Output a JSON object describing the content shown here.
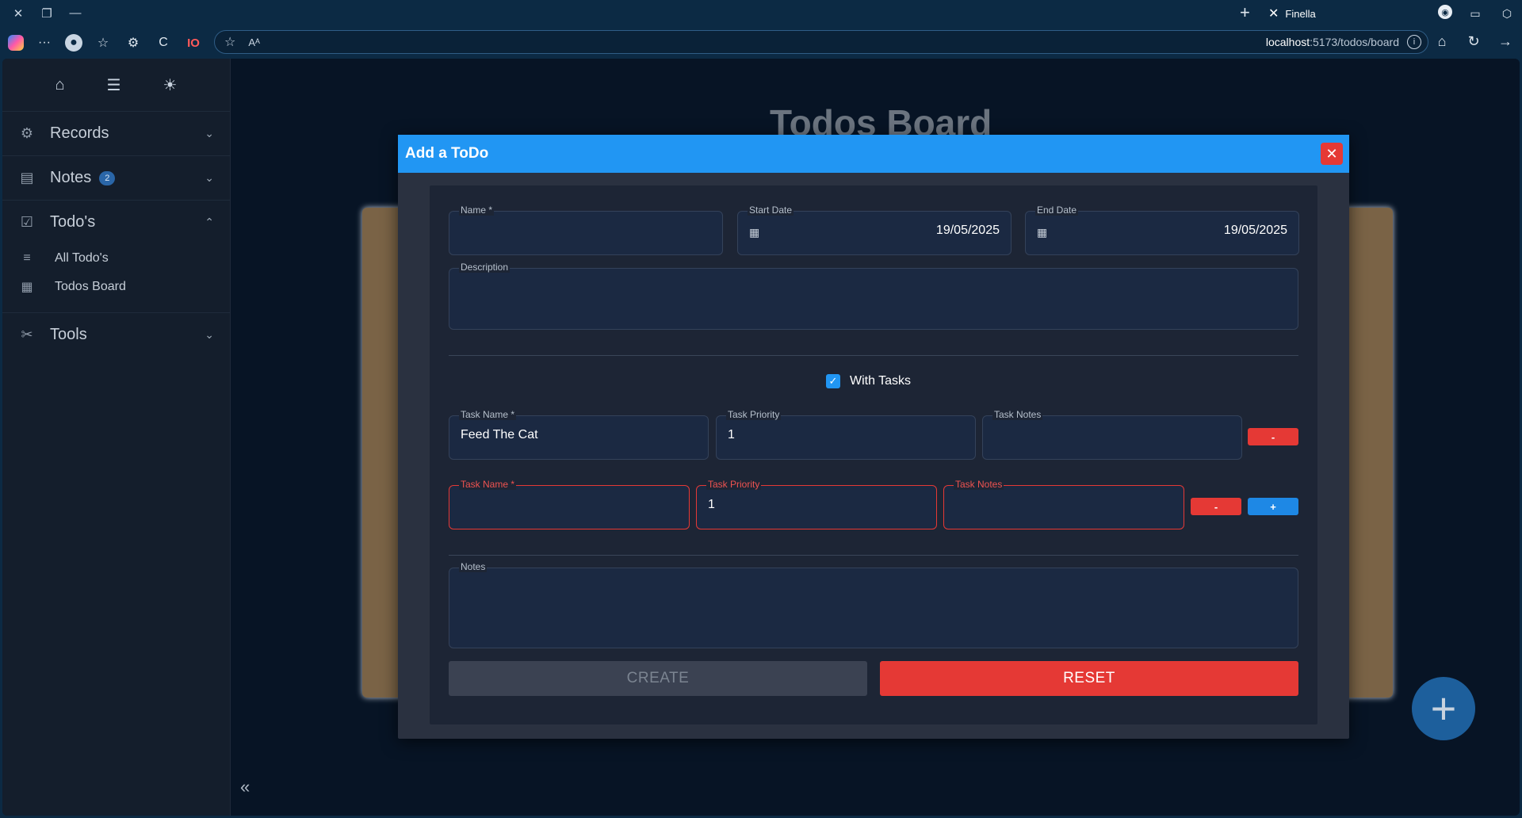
{
  "browser": {
    "tab_title": "Finella",
    "url_host": "localhost",
    "url_path": ":5173/todos/board",
    "ext_label": "IO"
  },
  "sidebar": {
    "sections": [
      {
        "label": "Records",
        "icon": "records-icon"
      },
      {
        "label": "Notes",
        "icon": "notes-icon",
        "badge": "2"
      },
      {
        "label": "Todo's",
        "icon": "todos-icon"
      },
      {
        "label": "Tools",
        "icon": "tools-icon"
      }
    ],
    "todo_items": [
      {
        "label": "All Todo's",
        "icon": "edit-list-icon"
      },
      {
        "label": "Todos Board",
        "icon": "board-icon"
      }
    ]
  },
  "page": {
    "title": "Todos Board"
  },
  "modal": {
    "title": "Add a ToDo",
    "name_label": "Name",
    "name_value": "",
    "start_label": "Start Date",
    "start_value": "19/05/2025",
    "end_label": "End Date",
    "end_value": "19/05/2025",
    "description_label": "Description",
    "with_tasks_label": "With Tasks",
    "with_tasks_checked": true,
    "tasks": [
      {
        "name_label": "Task Name",
        "name_value": "Feed The Cat",
        "priority_label": "Task Priority",
        "priority_value": "1",
        "notes_label": "Task Notes",
        "notes_value": "",
        "error": false
      },
      {
        "name_label": "Task Name",
        "name_value": "",
        "priority_label": "Task Priority",
        "priority_value": "1",
        "notes_label": "Task Notes",
        "notes_value": "",
        "error": true
      }
    ],
    "remove_label": "-",
    "add_label": "+",
    "notes_label": "Notes",
    "create_label": "CREATE",
    "reset_label": "RESET"
  },
  "colors": {
    "accent": "#2196f3",
    "danger": "#e53935",
    "board": "#7a6346"
  }
}
